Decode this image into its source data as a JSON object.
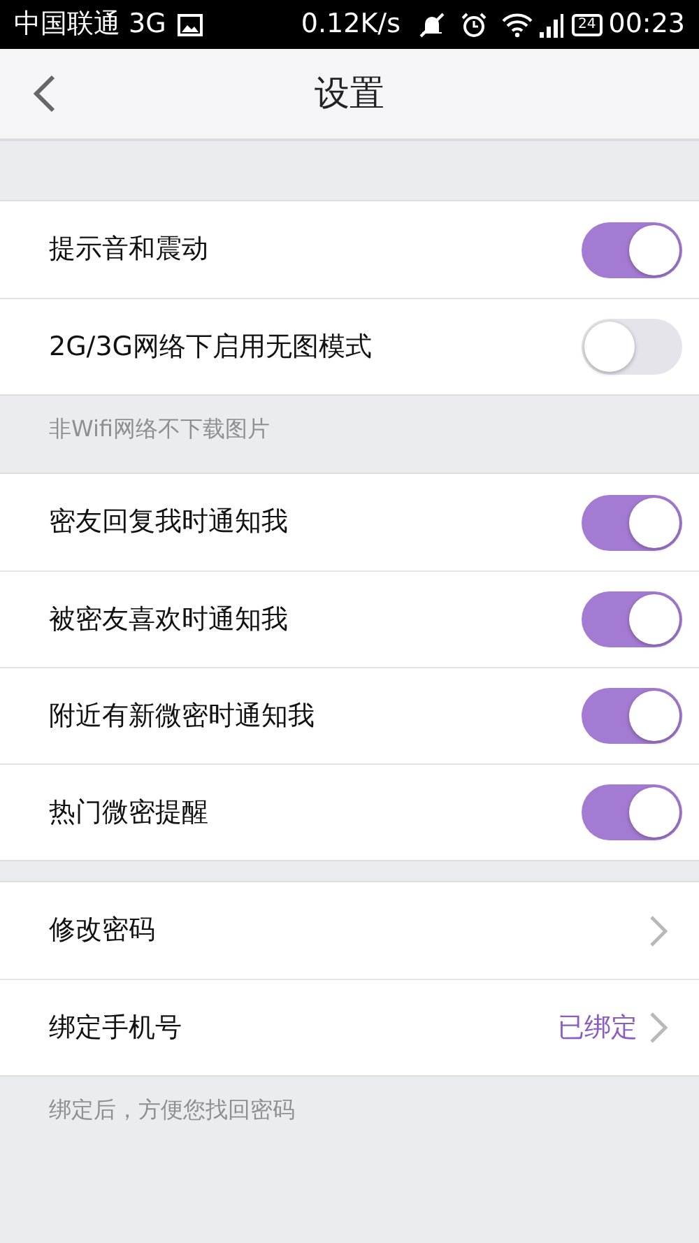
{
  "status_bar": {
    "carrier": "中国联通 3G",
    "speed": "0.12K/s",
    "battery": "24",
    "time": "00:23"
  },
  "header": {
    "title": "设置"
  },
  "sections": [
    {
      "rows": [
        {
          "kind": "toggle",
          "label": "提示音和震动",
          "on": true
        },
        {
          "kind": "toggle",
          "label": "2G/3G网络下启用无图模式",
          "on": false
        }
      ],
      "footnote": "非Wifi网络不下载图片"
    },
    {
      "rows": [
        {
          "kind": "toggle",
          "label": "密友回复我时通知我",
          "on": true
        },
        {
          "kind": "toggle",
          "label": "被密友喜欢时通知我",
          "on": true
        },
        {
          "kind": "toggle",
          "label": "附近有新微密时通知我",
          "on": true
        },
        {
          "kind": "toggle",
          "label": "热门微密提醒",
          "on": true
        }
      ]
    },
    {
      "rows": [
        {
          "kind": "link",
          "label": "修改密码"
        },
        {
          "kind": "link",
          "label": "绑定手机号",
          "value": "已绑定"
        }
      ],
      "footnote": "绑定后，方便您找回密码"
    }
  ]
}
